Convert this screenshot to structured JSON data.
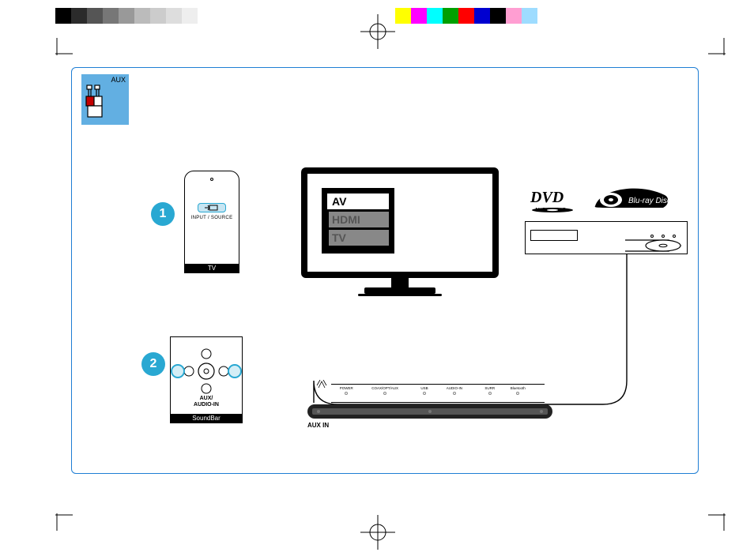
{
  "aux_label": "AUX",
  "step1": {
    "num": "1",
    "remote_label": "TV",
    "button_label": "INPUT / SOURCE"
  },
  "step2": {
    "num": "2",
    "remote_label": "SoundBar",
    "button_label": "AUX/\nAUDIO-IN"
  },
  "tv_menu": {
    "items": [
      "AV",
      "HDMI",
      "TV"
    ],
    "selected_index": 0
  },
  "logos": {
    "dvd_top": "DVD",
    "dvd_sub": "VIDEO",
    "bluray": "Blu-ray Disc"
  },
  "soundbar": {
    "indicators": [
      "POWER",
      "COAX/OPT/AUX",
      "USB",
      "AUDIO-IN",
      "SURR",
      "Bluetooth"
    ],
    "auxin": "AUX IN"
  }
}
